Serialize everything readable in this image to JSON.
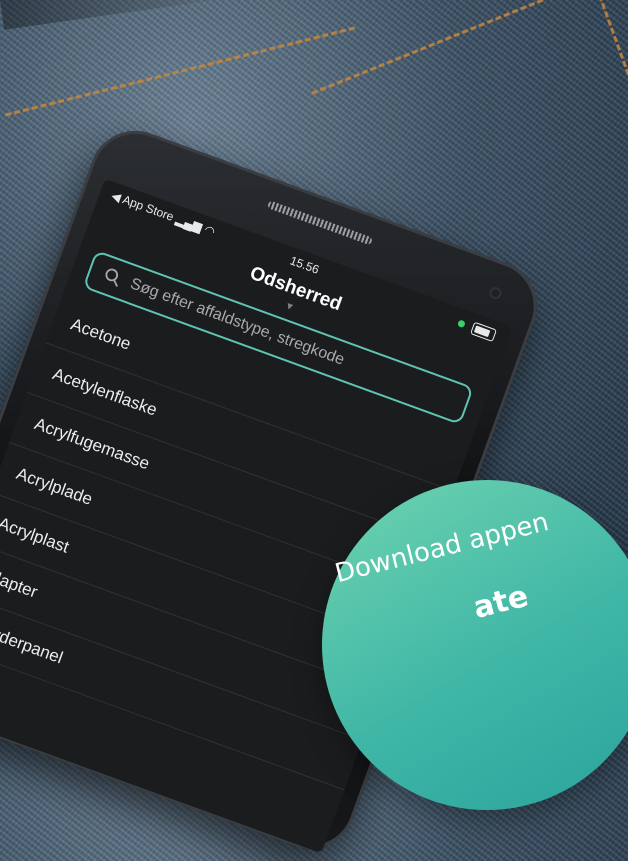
{
  "status_bar": {
    "carrier": "◀ App Store",
    "time": "15.56"
  },
  "header": {
    "title": "Odsherred"
  },
  "search": {
    "placeholder": "Søg efter affaldstype, stregkode"
  },
  "list": [
    {
      "label": "Acetone",
      "has_chevron": false
    },
    {
      "label": "Acetylenflaske",
      "has_chevron": false
    },
    {
      "label": "Acrylfugemasse",
      "has_chevron": true
    },
    {
      "label": "Acrylplade",
      "has_chevron": true
    },
    {
      "label": "Acrylplast",
      "has_chevron": false
    },
    {
      "label": "Adapter",
      "has_chevron": false
    },
    {
      "label": "Afbryderpanel",
      "has_chevron": false
    }
  ],
  "promo": {
    "line1": "Download appen",
    "line2": "ate"
  },
  "colors": {
    "accent": "#5fc3b4",
    "chevron": "#4fa3e8",
    "promo_circle": "#3fb6a6"
  }
}
